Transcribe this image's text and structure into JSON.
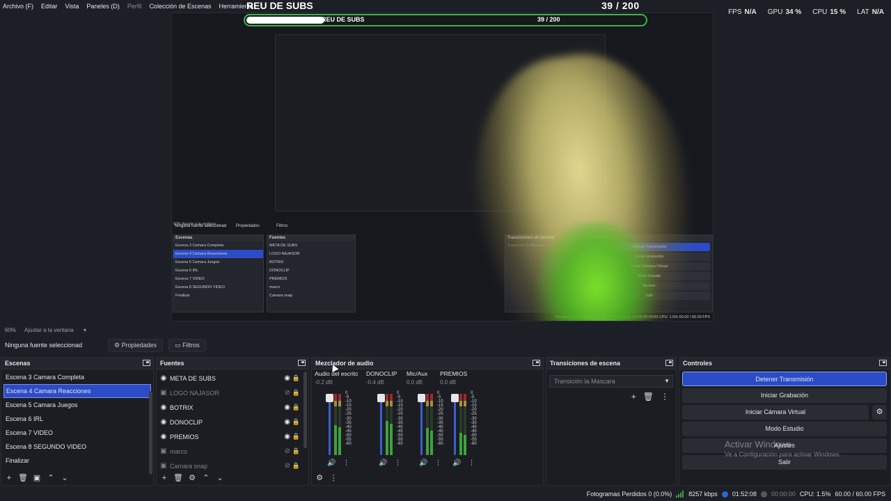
{
  "menu": [
    "Archivo (F)",
    "Editar",
    "Vista",
    "Paneles (D)",
    "Perfil",
    "Colección de Escenas",
    "Herramienta"
  ],
  "overlay": {
    "title": "REU DE SUBS",
    "count": "39   / 200",
    "bar_title": "REU DE SUBS",
    "bar_count": "39  / 200",
    "progress": 0.195
  },
  "stats": {
    "fps_label": "FPS",
    "fps": "N/A",
    "gpu_label": "GPU",
    "gpu": "34 %",
    "cpu_label": "CPU",
    "cpu": "15 %",
    "lat_label": "LAT",
    "lat": "N/A"
  },
  "preview_mini": {
    "nosource": "Ninguna fuente seleccionad",
    "props": "Propiedades",
    "filters": "Filtros",
    "scenes_title": "Escenas",
    "sources_title": "Fuentes",
    "trans_title": "Transiciones de escena",
    "ctrl_title": "Controles",
    "scenes": [
      "Escena 3 Camara Completa",
      "Escena 4 Camara Reacciones",
      "Escena 5  Camara Juegos",
      "Escena 6 IRL",
      "Escena 7 VIDEO",
      "Escena 8 SEGUNDO VIDEO",
      "Finalizar"
    ],
    "sources": [
      "META DE SUBS",
      "LOGO NAJASOR",
      "BOTRIX",
      "DONOCLIP",
      "PREMIOS",
      "marco",
      "Camara snap"
    ],
    "trans_value": "Transición la Mascara",
    "controls": [
      "Detener Transmisión",
      "Iniciar Grabación",
      "Iniciar Cámara Virtual",
      "Modo Estudio",
      "Ajustes",
      "Salir"
    ],
    "zoom": "60%   Ajustar a la ventana",
    "status": "Fotogramas Perdidos 0 (0.0%)    8257 kbps    01:52:08    00:00:00    CPU: 1.5%    60.00 / 60.00 FPS"
  },
  "zoom_bar": {
    "zoom": "60%",
    "fit": "Ajustar a la ventana"
  },
  "source_bar": {
    "no_source": "Ninguna fuente seleccionad",
    "properties": "Propiedades",
    "filters": "Filtros"
  },
  "scenes": {
    "title": "Escenas",
    "items": [
      "Escena 3 Camara Completa",
      "Escena 4  Camara Reacciones",
      "Escena 5   Camara Juegos",
      "Escena 6  IRL",
      "Escena 7 VIDEO",
      "Escena 8 SEGUNDO VIDEO",
      "Finalizar"
    ],
    "selected": 1
  },
  "sources": {
    "title": "Fuentes",
    "items": [
      {
        "name": "META DE SUBS",
        "visible": true
      },
      {
        "name": "LOGO NAJASOR",
        "visible": false
      },
      {
        "name": "BOTRIX",
        "visible": true
      },
      {
        "name": "DONOCLIP",
        "visible": true
      },
      {
        "name": "PREMIOS",
        "visible": true
      },
      {
        "name": "marco",
        "visible": false
      },
      {
        "name": "Camara snap",
        "visible": false
      }
    ]
  },
  "mixer": {
    "title": "Mezclador de audio",
    "channels": [
      {
        "name": "Audio del escrito",
        "db": "-0.2 dB",
        "level": 0.62
      },
      {
        "name": "DONOCLIP",
        "db": "-0.4 dB",
        "level": 0.7
      },
      {
        "name": "Mic/Aux",
        "db": "0.0 dB",
        "level": 0.55
      },
      {
        "name": "PREMIOS",
        "db": "0.0 dB",
        "level": 0.45
      }
    ],
    "scale": [
      "0",
      "-5",
      "-10",
      "-15",
      "-20",
      "-25",
      "-30",
      "-35",
      "-40",
      "-45",
      "-50",
      "-55",
      "-60"
    ]
  },
  "transitions": {
    "title": "Transiciones de escena",
    "value": "Transición la Mascara"
  },
  "controls": {
    "title": "Controles",
    "stop_stream": "Detener Transmisión",
    "start_record": "Iniciar Grabación",
    "start_vcam": "Iniciar Cámara Virtual",
    "studio_mode": "Modo Estudio",
    "settings": "Ajustes",
    "exit": "Salir"
  },
  "watermark": {
    "line1": "Activar Windows",
    "line2": "Ve a Configuración para activar Windows."
  },
  "status": {
    "dropped": "Fotogramas Perdidos 0 (0.0%)",
    "bitrate": "8257 kbps",
    "stream_time": "01:52:08",
    "rec_time": "00:00:00",
    "cpu": "CPU: 1.5%",
    "fps": "60.00 / 60.00 FPS"
  },
  "colors": {
    "accent": "#2b4cc6",
    "bg": "#1d1f26",
    "green": "#3ea33a"
  }
}
